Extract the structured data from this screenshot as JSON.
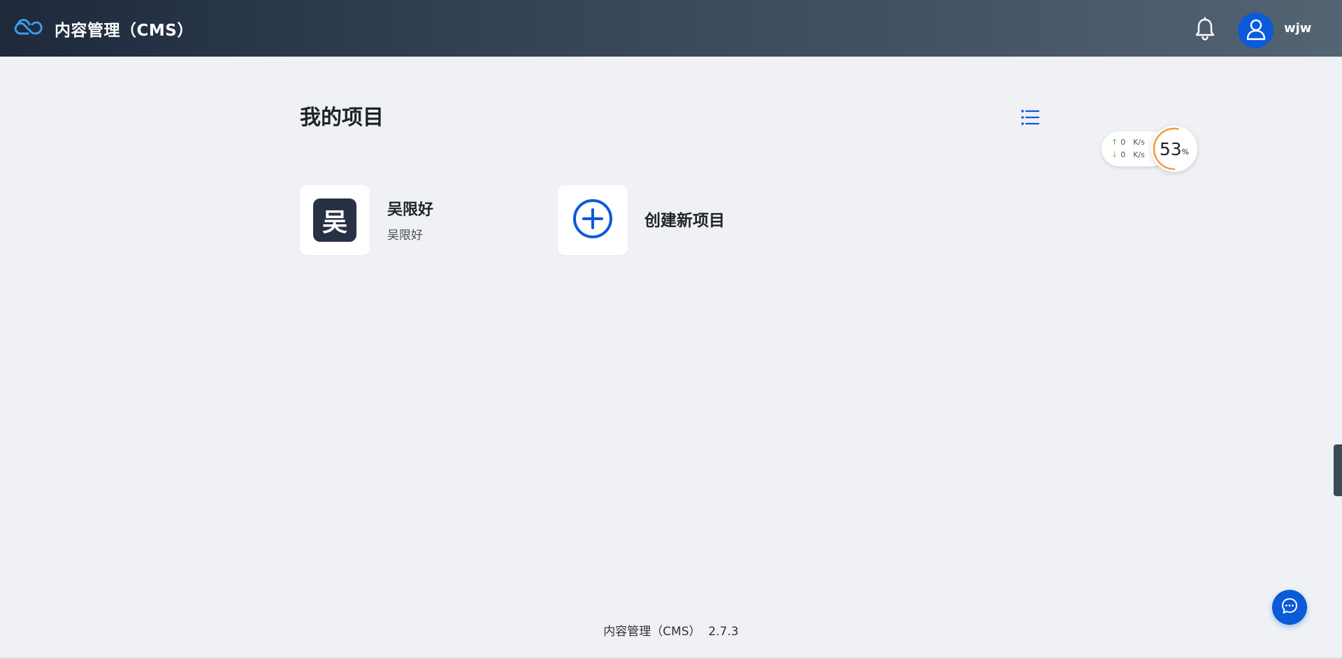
{
  "header": {
    "title": "内容管理（CMS）",
    "logo_icon": "cloud-logo-icon",
    "notification_icon": "bell-icon",
    "user": {
      "avatar_icon": "user-icon",
      "name": "wjw"
    }
  },
  "main": {
    "title": "我的项目",
    "view_toggle_icon": "list-view-icon",
    "projects": [
      {
        "badge": "吴",
        "name": "吴限好",
        "description": "吴限好"
      }
    ],
    "create_card": {
      "icon": "plus-circle-icon",
      "label": "创建新项目"
    }
  },
  "network_monitor": {
    "upload": {
      "value": "0",
      "unit": "K/s"
    },
    "download": {
      "value": "0",
      "unit": "K/s"
    },
    "usage_percent": 53,
    "usage_value": "53",
    "usage_unit": "%"
  },
  "footer": {
    "text": "内容管理（CMS）  2.7.3"
  },
  "chat": {
    "icon": "chat-bubble-icon"
  },
  "colors": {
    "primary": "#0b5ad9",
    "header_start": "#1e293b",
    "header_end": "#536472",
    "background": "#f0f1f4",
    "gauge": "#f29b39"
  }
}
